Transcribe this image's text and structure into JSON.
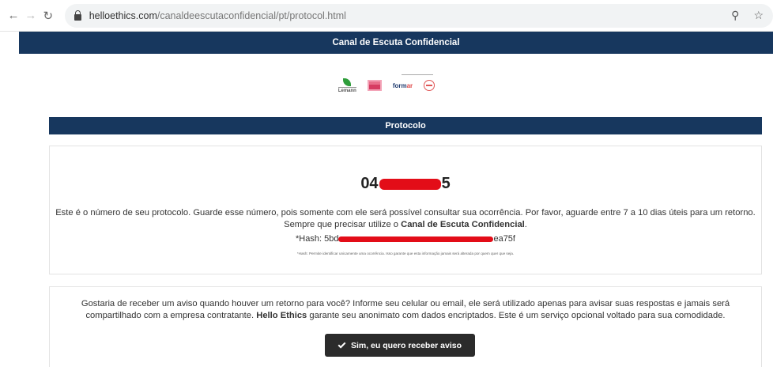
{
  "browser": {
    "back_icon": "arrow-left-icon",
    "forward_icon": "arrow-right-icon",
    "reload_icon": "reload-icon",
    "url_domain": "helloethics.com",
    "url_path": "/canaldeescutaconfidencial/pt/protocol.html",
    "zoom_icon": "zoom-icon",
    "bookmark_icon": "star-icon"
  },
  "header": {
    "title": "Canal de Escuta Confidencial"
  },
  "logos": {
    "lemann": "Lemann",
    "formar_a": "form",
    "formar_b": "ar"
  },
  "protocol_section": {
    "title": "Protocolo",
    "number_prefix": "04",
    "number_suffix": "5",
    "message_line1": "Este é o número de seu protocolo. Guarde esse número, pois somente com ele será possível consultar sua ocorrência. Por favor, aguarde entre 7 a 10 dias úteis para um retorno.",
    "message_line2_pre": "Sempre que precisar utilize o ",
    "message_line2_bold": "Canal de Escuta Confidencial",
    "message_line2_post": ".",
    "hash_prefix": "*Hash: 5bd",
    "hash_suffix": "ea75f",
    "hash_note": "*Hash: Permite identificar unicamente uma ocorrência. Isso garante que esta informação jamais será alterada por quem quer que seja."
  },
  "optin_section": {
    "text_line1": "Gostaria de receber um aviso quando houver um retorno para você? Informe seu celular ou email, ele será utilizado apenas para avisar suas respostas e jamais será",
    "text_line2_pre": "compartilhado com a empresa contratante. ",
    "text_line2_bold": "Hello Ethics",
    "text_line2_post": " garante seu anonimato com dados encriptados. Este é um serviço opcional voltado para sua comodidade.",
    "button_label": "Sim, eu quero receber aviso",
    "button_icon": "check-icon"
  },
  "colors": {
    "navy": "#17375e",
    "redaction": "#e30d18",
    "button": "#2b2b2b"
  }
}
